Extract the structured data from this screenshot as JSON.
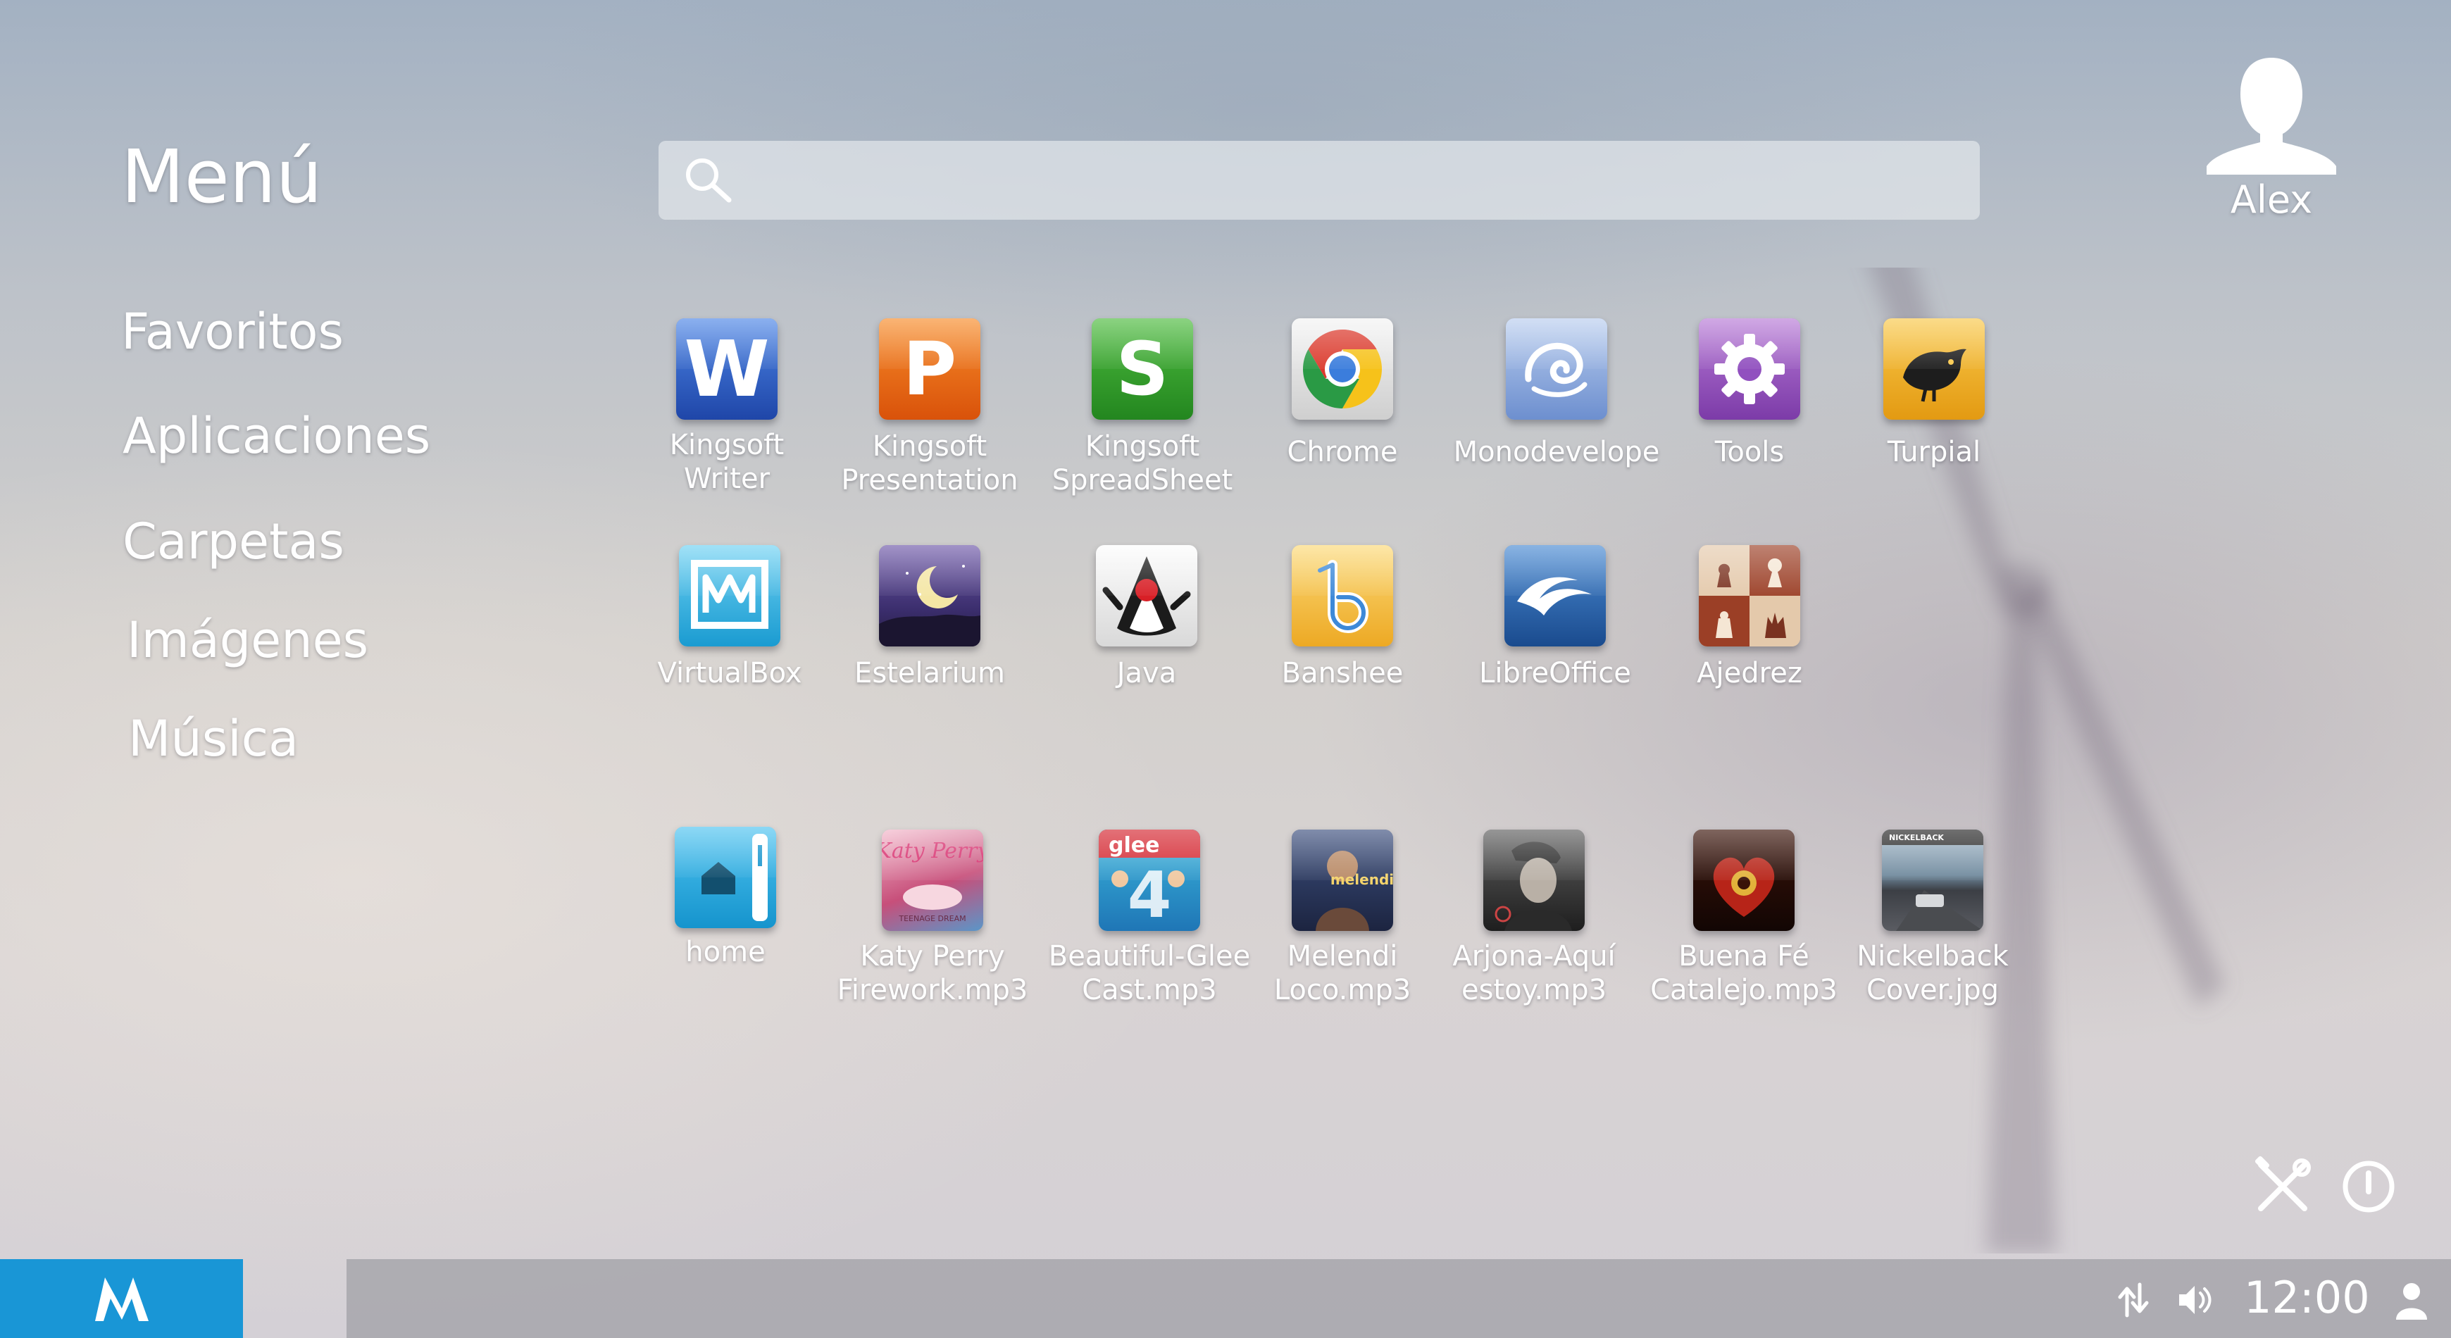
{
  "menu": {
    "title": "Menú",
    "items": [
      {
        "label": "Favoritos"
      },
      {
        "label": "Aplicaciones"
      },
      {
        "label": "Carpetas"
      },
      {
        "label": "Imágenes"
      },
      {
        "label": "Música"
      }
    ]
  },
  "search": {
    "placeholder": "",
    "value": "",
    "icon": "search-icon"
  },
  "user": {
    "name": "Alex",
    "icon": "user-avatar-icon"
  },
  "apps": [
    {
      "label": "Kingsoft\nWriter",
      "icon": "kingsoft-writer-icon",
      "letter": "W",
      "color": "#2f5fc2"
    },
    {
      "label": "Kingsoft\nPresentation",
      "icon": "kingsoft-presentation-icon",
      "letter": "P",
      "color": "#e4630f"
    },
    {
      "label": "Kingsoft\nSpreadSheet",
      "icon": "kingsoft-spreadsheet-icon",
      "letter": "S",
      "color": "#2f9a2a"
    },
    {
      "label": "Chrome",
      "icon": "chrome-icon"
    },
    {
      "label": "Monodevelope",
      "icon": "monodevelop-icon"
    },
    {
      "label": "Tools",
      "icon": "tools-gear-icon"
    },
    {
      "label": "Turpial",
      "icon": "turpial-bird-icon"
    },
    {
      "label": "VirtualBox",
      "icon": "virtualbox-icon"
    },
    {
      "label": "Estelarium",
      "icon": "stellarium-moon-icon"
    },
    {
      "label": "Java",
      "icon": "java-duke-icon"
    },
    {
      "label": "Banshee",
      "icon": "banshee-icon"
    },
    {
      "label": "LibreOffice",
      "icon": "libreoffice-icon"
    },
    {
      "label": "Ajedrez",
      "icon": "chess-icon"
    }
  ],
  "files": [
    {
      "label": "home",
      "icon": "home-folder-icon"
    },
    {
      "label": "Katy Perry\nFirework.mp3",
      "icon": "album-cover-katy-perry-icon"
    },
    {
      "label": "Beautiful-Glee\nCast.mp3",
      "icon": "album-cover-glee-icon"
    },
    {
      "label": "Melendi\nLoco.mp3",
      "icon": "album-cover-melendi-icon"
    },
    {
      "label": "Arjona-Aquí\nestoy.mp3",
      "icon": "album-cover-arjona-icon"
    },
    {
      "label": "Buena Fé\nCatalejo.mp3",
      "icon": "album-cover-buena-fe-icon"
    },
    {
      "label": "Nickelback\nCover.jpg",
      "icon": "image-nickelback-cover-icon"
    }
  ],
  "actions": {
    "settings_icon": "tools-cross-icon",
    "power_icon": "power-icon"
  },
  "taskbar": {
    "start_icon": "m-logo-icon",
    "network_icon": "network-arrows-icon",
    "volume_icon": "volume-icon",
    "clock": "12:00",
    "user_icon": "user-icon",
    "start_color": "#1996d6"
  }
}
